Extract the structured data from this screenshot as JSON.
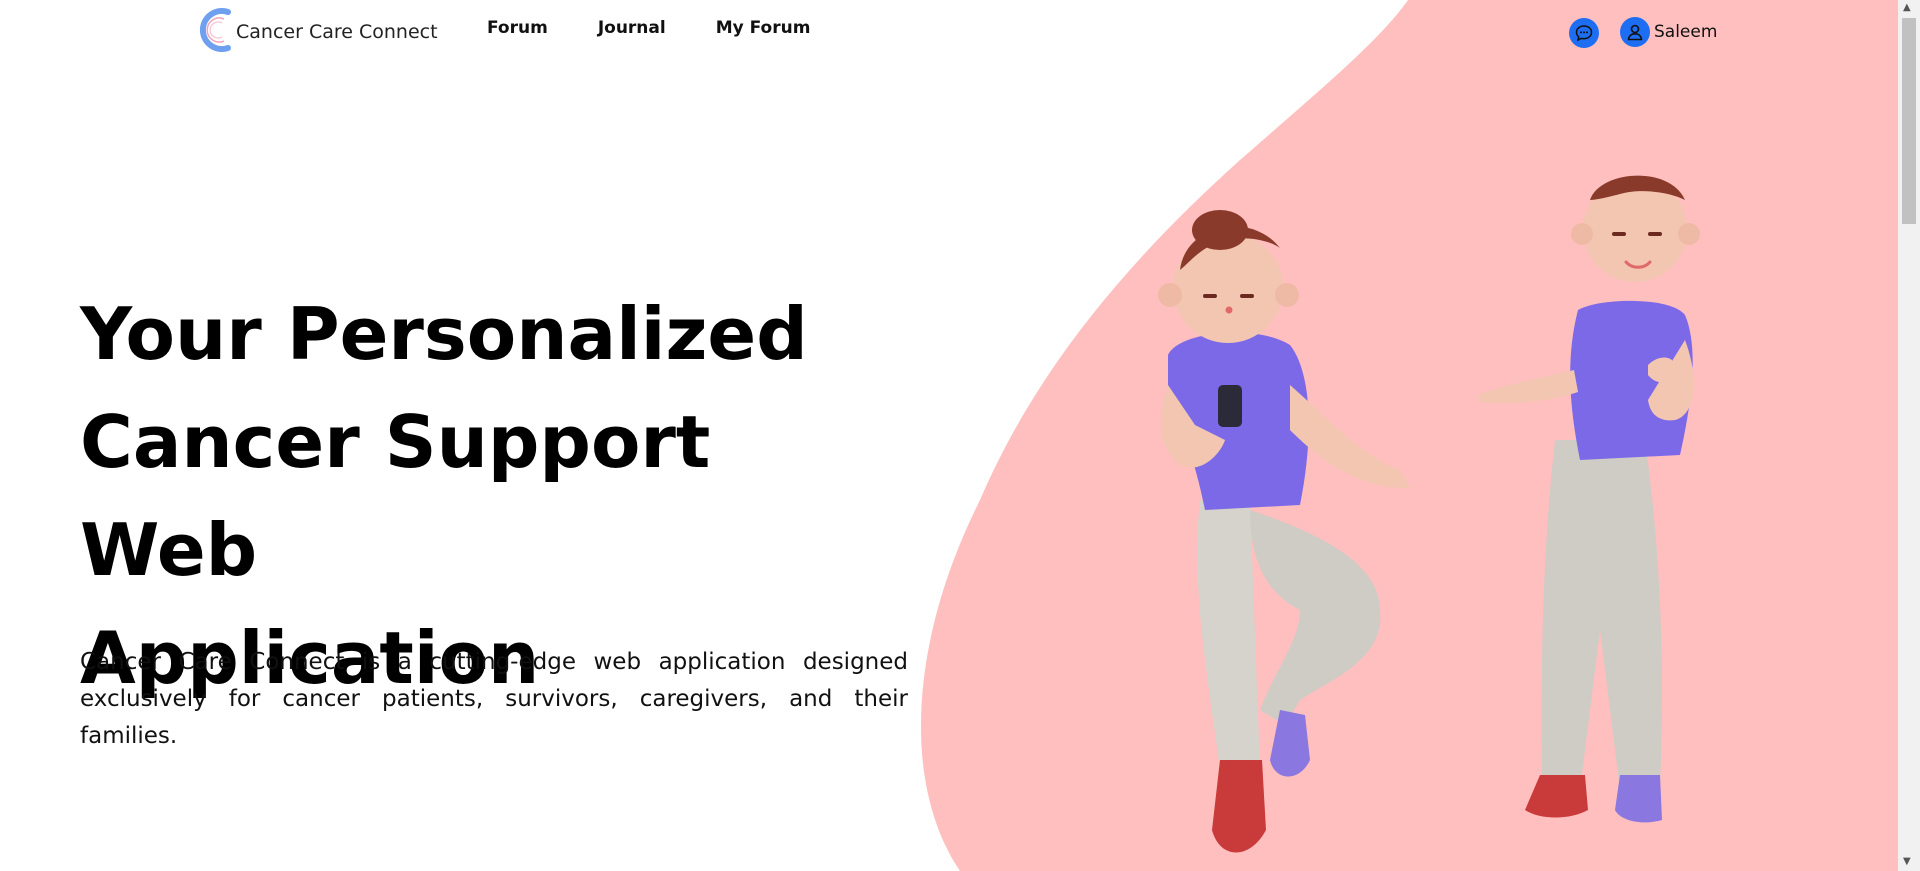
{
  "app": {
    "name": "Cancer Care Connect",
    "colors": {
      "accent": "#1e6ef4",
      "blob": "#ffbfbf",
      "text": "#000000"
    }
  },
  "nav": {
    "links": [
      "Forum",
      "Journal",
      "My Forum"
    ],
    "chat_icon": "chat-icon",
    "user_icon": "user-icon",
    "user_name": "Saleem"
  },
  "hero": {
    "title_lines": [
      "Your Personalized",
      "Cancer Support Web",
      "Application"
    ],
    "description": "Cancer Care Connect is a cutting-edge web application designed exclusively for cancer patients, survivors, caregivers, and their families."
  },
  "illustration": {
    "subject": "two cartoon characters in purple t-shirts and grey pants"
  }
}
